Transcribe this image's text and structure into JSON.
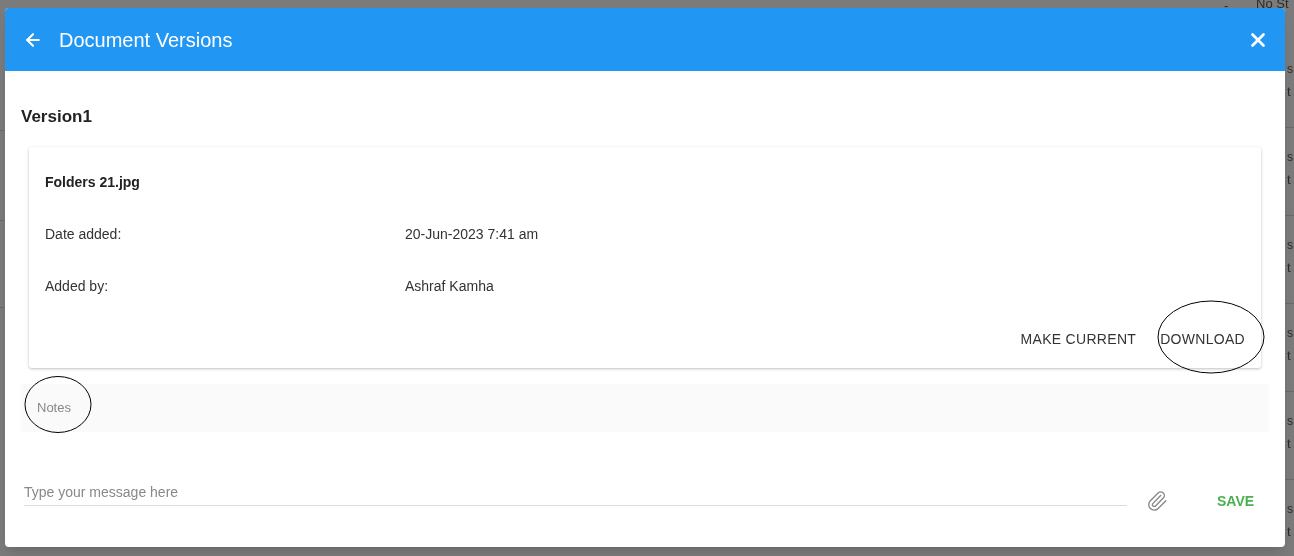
{
  "background": {
    "top": [
      "-",
      "No St"
    ],
    "rows": [
      {
        "line_1": "s",
        "line_2": "t"
      },
      {
        "line_1": "s",
        "line_2": "t"
      },
      {
        "line_1": "s",
        "line_2": "t"
      },
      {
        "line_1": "s",
        "line_2": "t"
      },
      {
        "line_1": "s",
        "line_2": "t"
      },
      {
        "line_1": "s",
        "line_2": "t"
      }
    ]
  },
  "dialog": {
    "title": "Document Versions",
    "versions": [
      {
        "heading": "Version1",
        "file_name": "Folders 21.jpg",
        "fields": [
          {
            "label": "Date added:",
            "value": "20-Jun-2023 7:41 am"
          },
          {
            "label": "Added by:",
            "value": "Ashraf Kamha"
          }
        ],
        "actions": [
          "MAKE CURRENT",
          "DOWNLOAD"
        ]
      }
    ],
    "notes_label": "Notes",
    "message": {
      "placeholder": "Type your message here"
    },
    "save_label": "SAVE"
  }
}
